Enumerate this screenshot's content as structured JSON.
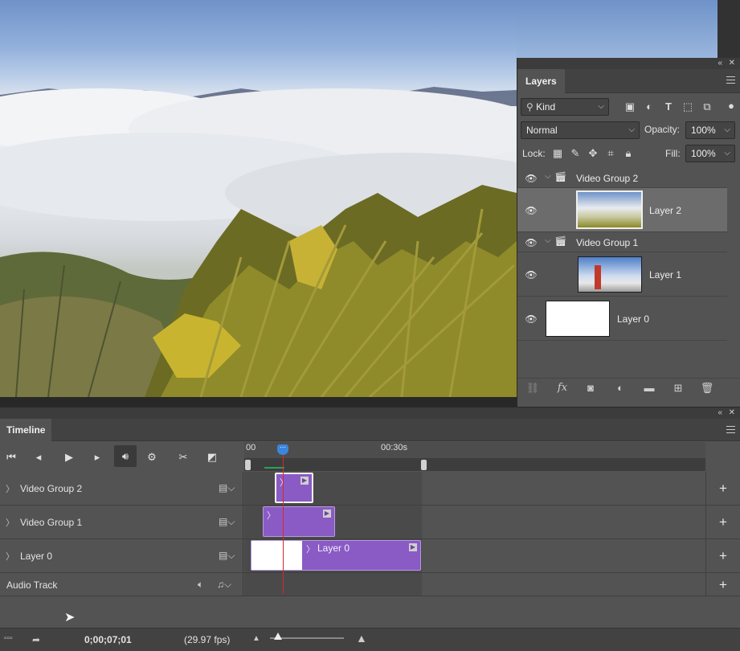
{
  "layers_panel": {
    "tab": "Layers",
    "filter_kind": "Kind",
    "blend_mode": "Normal",
    "opacity_label": "Opacity:",
    "opacity_value": "100%",
    "lock_label": "Lock:",
    "fill_label": "Fill:",
    "fill_value": "100%",
    "layers": [
      {
        "name": "Video Group 2",
        "type": "group"
      },
      {
        "name": "Layer 2",
        "type": "layer",
        "selected": true
      },
      {
        "name": "Video Group 1",
        "type": "group"
      },
      {
        "name": "Layer 1",
        "type": "layer"
      },
      {
        "name": "Layer 0",
        "type": "layer"
      }
    ]
  },
  "timeline": {
    "tab": "Timeline",
    "ruler_start": "00",
    "ruler_mark": "00:30s",
    "tracks": [
      {
        "name": "Video Group 2"
      },
      {
        "name": "Video Group 1"
      },
      {
        "name": "Layer 0",
        "clip_label": "Layer 0"
      },
      {
        "name": "Audio Track"
      }
    ],
    "timecode": "0;00;07;01",
    "fps": "(29.97 fps)"
  },
  "colors": {
    "panel_bg": "#535353",
    "clip_purple": "#8a5bc4",
    "playhead_red": "#d42a2a",
    "playhead_handle": "#3b86dc"
  }
}
